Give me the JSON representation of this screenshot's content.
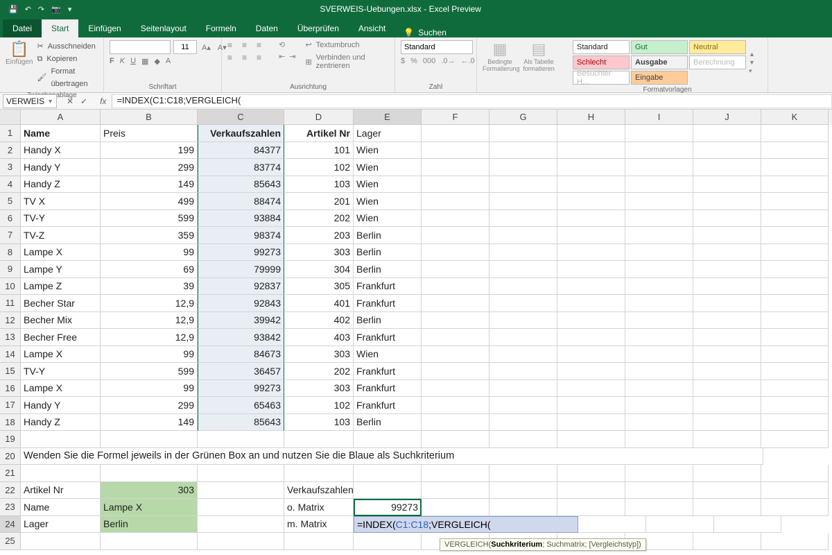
{
  "title": "SVERWEIS-Uebungen.xlsx - Excel Preview",
  "qat": {
    "save": "💾",
    "undo": "↶",
    "redo": "↷",
    "cam": "📷",
    "more": "▾"
  },
  "menu": {
    "file": "Datei",
    "tabs": [
      "Start",
      "Einfügen",
      "Seitenlayout",
      "Formeln",
      "Daten",
      "Überprüfen",
      "Ansicht"
    ],
    "tell": "Suchen"
  },
  "ribbon": {
    "clipboard": {
      "paste": "Einfügen",
      "cut": "Ausschneiden",
      "copy": "Kopieren",
      "format": "Format übertragen",
      "label": "Zwischenablage"
    },
    "font": {
      "size": "11",
      "label": "Schriftart"
    },
    "align": {
      "wrap": "Textumbruch",
      "merge": "Verbinden und zentrieren",
      "label": "Ausrichtung"
    },
    "number": {
      "format": "Standard",
      "label": "Zahl"
    },
    "cond": {
      "cond": "Bedingte Formatierung",
      "table": "Als Tabelle formatieren"
    },
    "styles": {
      "cells": [
        "Standard",
        "Gut",
        "Neutral",
        "Schlecht",
        "Ausgabe",
        "Berechnung",
        "Besuchter H…",
        "Eingabe"
      ],
      "label": "Formatvorlagen"
    }
  },
  "namebox": "VERWEIS",
  "formula": "=INDEX(C1:C18;VERGLEICH(",
  "columns": [
    "A",
    "B",
    "C",
    "D",
    "E",
    "F",
    "G",
    "H",
    "I",
    "J",
    "K"
  ],
  "headers": {
    "A": "Name",
    "B": "Preis",
    "C": "Verkaufszahlen",
    "D": "Artikel Nr",
    "E": "Lager"
  },
  "data": [
    {
      "A": "Handy X",
      "B": "199",
      "C": "84377",
      "D": "101",
      "E": "Wien"
    },
    {
      "A": "Handy Y",
      "B": "299",
      "C": "83774",
      "D": "102",
      "E": "Wien"
    },
    {
      "A": "Handy Z",
      "B": "149",
      "C": "85643",
      "D": "103",
      "E": "Wien"
    },
    {
      "A": "TV X",
      "B": "499",
      "C": "88474",
      "D": "201",
      "E": "Wien"
    },
    {
      "A": "TV-Y",
      "B": "599",
      "C": "93884",
      "D": "202",
      "E": "Wien"
    },
    {
      "A": "TV-Z",
      "B": "359",
      "C": "98374",
      "D": "203",
      "E": "Berlin"
    },
    {
      "A": "Lampe X",
      "B": "99",
      "C": "99273",
      "D": "303",
      "E": "Berlin"
    },
    {
      "A": "Lampe Y",
      "B": "69",
      "C": "79999",
      "D": "304",
      "E": "Berlin"
    },
    {
      "A": "Lampe Z",
      "B": "39",
      "C": "92837",
      "D": "305",
      "E": "Frankfurt"
    },
    {
      "A": "Becher Star",
      "B": "12,9",
      "C": "92843",
      "D": "401",
      "E": "Frankfurt"
    },
    {
      "A": "Becher Mix",
      "B": "12,9",
      "C": "39942",
      "D": "402",
      "E": "Berlin"
    },
    {
      "A": "Becher Free",
      "B": "12,9",
      "C": "93842",
      "D": "403",
      "E": "Frankfurt"
    },
    {
      "A": "Lampe X",
      "B": "99",
      "C": "84673",
      "D": "303",
      "E": "Wien"
    },
    {
      "A": "TV-Y",
      "B": "599",
      "C": "36457",
      "D": "202",
      "E": "Frankfurt"
    },
    {
      "A": "Lampe X",
      "B": "99",
      "C": "99273",
      "D": "303",
      "E": "Frankfurt"
    },
    {
      "A": "Handy Y",
      "B": "299",
      "C": "65463",
      "D": "102",
      "E": "Frankfurt"
    },
    {
      "A": "Handy Z",
      "B": "149",
      "C": "85643",
      "D": "103",
      "E": "Berlin"
    }
  ],
  "instruction": "Wenden Sie die Formel jeweils in der Grünen Box an und nutzen Sie die Blaue als Suchkriterium",
  "lookup": {
    "r22": {
      "A": "Artikel Nr",
      "B": "303",
      "D": "Verkaufszahlen"
    },
    "r23": {
      "A": "Name",
      "B": "Lampe X",
      "D": "o. Matrix",
      "E": "99273"
    },
    "r24": {
      "A": "Lager",
      "B": "Berlin",
      "D": "m. Matrix",
      "E": "=INDEX(C1:C18;VERGLEICH("
    }
  },
  "formula_parts": {
    "p1": "=INDEX(",
    "p2": "C1:C18",
    "p3": ";VERGLEICH("
  },
  "tooltip": {
    "fn": "VERGLEICH(",
    "arg1": "Suchkriterium",
    "rest": "; Suchmatrix; [Vergleichstyp])"
  }
}
